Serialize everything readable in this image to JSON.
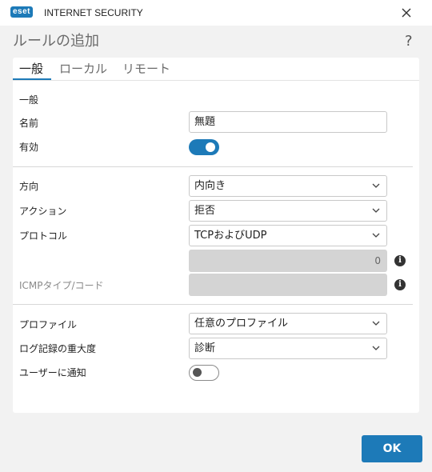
{
  "app": {
    "logo": "eset",
    "title": "INTERNET SECURITY"
  },
  "dialog": {
    "title": "ルールの追加",
    "help": "?"
  },
  "tabs": [
    {
      "label": "一般",
      "active": true
    },
    {
      "label": "ローカル",
      "active": false
    },
    {
      "label": "リモート",
      "active": false
    }
  ],
  "general": {
    "section_label": "一般",
    "name_label": "名前",
    "name_value": "無題",
    "enabled_label": "有効",
    "enabled": true
  },
  "rule": {
    "direction_label": "方向",
    "direction_value": "内向き",
    "action_label": "アクション",
    "action_value": "拒否",
    "protocol_label": "プロトコル",
    "protocol_value": "TCPおよびUDP",
    "protocol_number_value": "0",
    "icmp_label": "ICMPタイプ/コード",
    "icmp_value": ""
  },
  "profile": {
    "profile_label": "プロファイル",
    "profile_value": "任意のプロファイル",
    "log_label": "ログ記録の重大度",
    "log_value": "診断",
    "notify_label": "ユーザーに通知",
    "notify": false
  },
  "footer": {
    "ok_label": "OK"
  },
  "colors": {
    "accent": "#1d7ab8",
    "background": "#f2f2f2",
    "disabled_field": "#d4d4d4"
  },
  "icons": [
    "close-icon",
    "help-icon",
    "chevron-down-icon",
    "info-icon"
  ]
}
